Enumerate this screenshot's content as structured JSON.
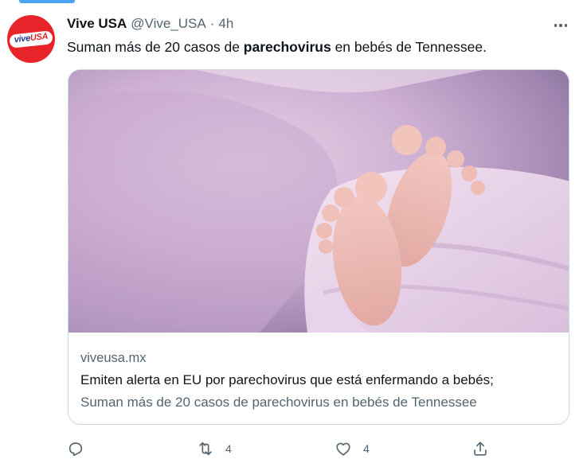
{
  "tweet": {
    "display_name": "Vive USA",
    "handle": "@Vive_USA",
    "separator": "·",
    "time": "4h",
    "text_before": "Suman más de 20 casos de ",
    "text_bold": "parechovirus",
    "text_after": " en bebés de Tennessee.",
    "avatar_logo": {
      "part1": "vive",
      "part2": "USA"
    }
  },
  "card": {
    "image_alt": "baby-feet-in-pink-blanket",
    "domain": "viveusa.mx",
    "title": "Emiten alerta en EU por parechovirus que está enfermando a bebés;",
    "description": "Suman más de 20 casos de parechovirus en bebés de Tennessee"
  },
  "actions": {
    "reply": {
      "icon": "reply-icon",
      "count": ""
    },
    "retweet": {
      "icon": "retweet-icon",
      "count": "4"
    },
    "like": {
      "icon": "heart-icon",
      "count": "4"
    },
    "share": {
      "icon": "share-icon",
      "count": ""
    }
  },
  "colors": {
    "text_primary": "#0f1419",
    "text_secondary": "#536471",
    "border": "#cfd9de",
    "avatar_red": "#e8232a",
    "avatar_blue": "#1d3a8a"
  }
}
